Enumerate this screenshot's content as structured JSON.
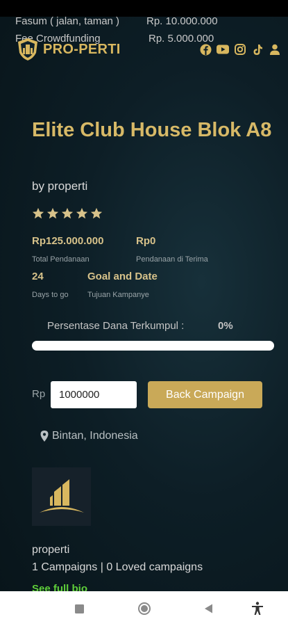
{
  "overlay": {
    "line1_left": "Fasum ( jalan, taman )",
    "line1_right": "Rp. 10.000.000",
    "line2_left": "Fee Crowdfunding",
    "line2_right": "Rp. 5.000.000"
  },
  "header": {
    "brand": "PRO-PERTI",
    "brand_color": "#d8b75f",
    "socials": [
      "facebook-icon",
      "youtube-icon",
      "instagram-icon",
      "tiktok-icon",
      "user-icon"
    ]
  },
  "campaign": {
    "title": "Elite Club House Blok A8",
    "byline": "by properti",
    "rating": 5,
    "stats": {
      "total_value": "Rp125.000.000",
      "total_label": "Total Pendanaan",
      "received_value": "Rp0",
      "received_label": "Pendanaan di Terima",
      "days_value": "24",
      "days_label": "Days to go",
      "goal_value": "Goal and Date",
      "goal_label": "Tujuan Kampanye"
    },
    "progress": {
      "label": "Persentase Dana Terkumpul :",
      "percent_text": "0%",
      "percent": 0
    },
    "donate": {
      "currency": "Rp",
      "amount": "1000000",
      "button": "Back Campaign"
    },
    "location": "Bintan, Indonesia"
  },
  "author": {
    "name": "properti",
    "stats": "1 Campaigns | 0 Loved campaigns",
    "full_bio": "See full bio"
  },
  "colors": {
    "accent": "#d7b967",
    "button": "#c9a958",
    "bio_link": "#5fcf3a"
  }
}
